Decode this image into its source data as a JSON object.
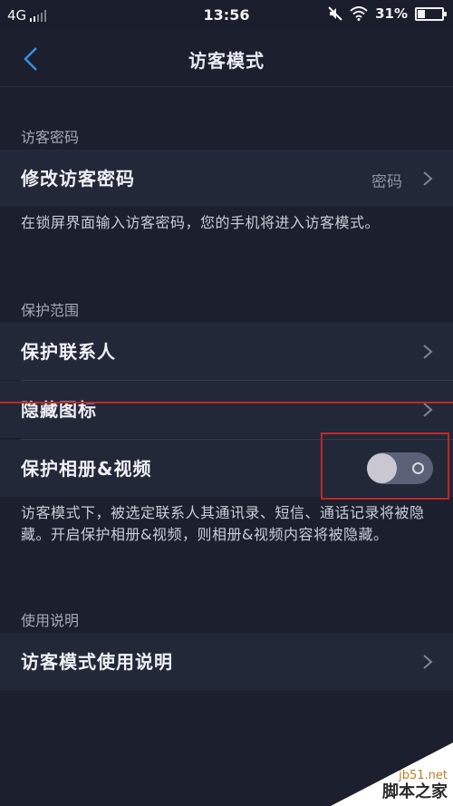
{
  "status_bar": {
    "network": "4G",
    "time": "13:56",
    "battery_percent": "31%",
    "battery_level": 0.31,
    "icons": [
      "signal-icon",
      "mute-icon",
      "wifi-icon",
      "battery-icon"
    ]
  },
  "nav": {
    "title": "访客模式",
    "back_icon": "chevron-left-icon",
    "accent_color": "#3a8ee6"
  },
  "sections": {
    "password": {
      "header": "访客密码",
      "row_label": "修改访客密码",
      "row_value": "密码",
      "description": "在锁屏界面输入访客密码，您的手机将进入访客模式。"
    },
    "protection": {
      "header": "保护范围",
      "rows": {
        "contacts": "保护联系人",
        "hide_icon": "隐藏图标",
        "album_video": "保护相册&视频"
      },
      "album_toggle_on": false,
      "description": "访客模式下，被选定联系人其通讯录、短信、通话记录将被隐藏。开启保护相册&视频，则相册&视频内容将被隐藏。"
    },
    "help": {
      "header": "使用说明",
      "row_label": "访客模式使用说明"
    }
  },
  "annotation_color": "#c0262c",
  "watermark": {
    "site": "jb51.net",
    "name": "脚本之家"
  }
}
